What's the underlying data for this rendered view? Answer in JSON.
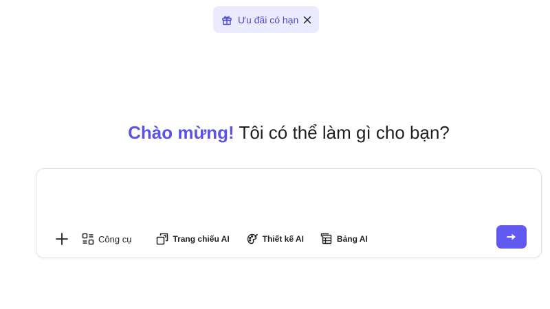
{
  "promo": {
    "label": "Ưu đãi có hạn",
    "icon": "gift-icon",
    "close_icon": "close-icon",
    "accent_color": "#4b47c9",
    "background_color": "#eceaff"
  },
  "greeting": {
    "highlight": "Chào mừng!",
    "text": "Tôi có thể làm gì cho bạn?",
    "highlight_color": "#5b52e8"
  },
  "chat": {
    "placeholder": "",
    "value": ""
  },
  "toolbar": {
    "add_icon": "plus-icon",
    "tools": [
      {
        "label": "Công cụ",
        "icon": "tools-icon"
      },
      {
        "label": "Trang chiếu AI",
        "icon": "slides-icon"
      },
      {
        "label": "Thiết kế AI",
        "icon": "palette-icon"
      },
      {
        "label": "Bảng AI",
        "icon": "table-icon"
      }
    ],
    "send_icon": "arrow-right-icon",
    "send_color": "#6259f0"
  }
}
